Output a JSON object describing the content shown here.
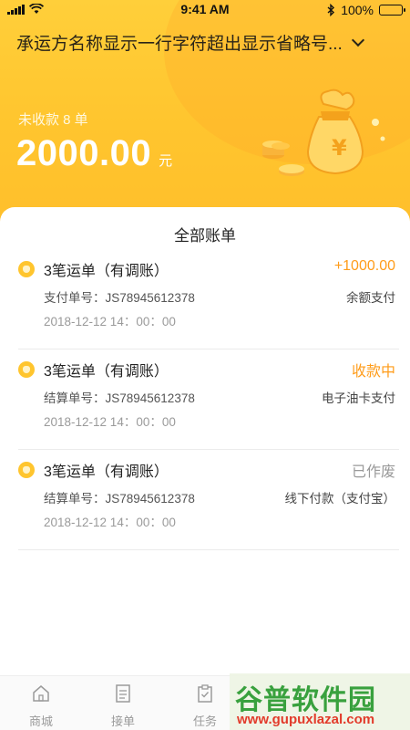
{
  "status_bar": {
    "time": "9:41 AM",
    "battery": "100%",
    "icons": [
      "signal-icon",
      "wifi-icon",
      "bluetooth-icon",
      "battery-icon"
    ]
  },
  "header": {
    "carrier_name": "承运方名称显示一行字符超出显示省略号...",
    "uncollected_label": "未收款 8 单",
    "amount": "2000.00",
    "currency": "元",
    "colors": {
      "primary": "#ffc52e",
      "accent_orange": "#ff9c1a"
    }
  },
  "bills": {
    "title": "全部账单",
    "items": [
      {
        "title": "3笔运单（有调账）",
        "status": "+1000.00",
        "status_color": "#ff9c1a",
        "number": "支付单号：JS78945612378",
        "method": "余额支付",
        "time": "2018-12-12  14：00：00"
      },
      {
        "title": "3笔运单（有调账）",
        "status": "收款中",
        "status_color": "#ff9c1a",
        "number": "结算单号：JS78945612378",
        "method": "电子油卡支付",
        "time": "2018-12-12  14：00：00"
      },
      {
        "title": "3笔运单（有调账）",
        "status": "已作废",
        "status_color": "#999999",
        "number": "结算单号：JS78945612378",
        "method": "线下付款（支付宝）",
        "time": "2018-12-12  14：00：00"
      }
    ]
  },
  "tabbar": {
    "tabs": [
      {
        "label": "商城",
        "icon": "home-icon"
      },
      {
        "label": "接单",
        "icon": "document-icon"
      },
      {
        "label": "任务",
        "icon": "clipboard-icon"
      }
    ]
  },
  "watermark": {
    "main": "谷普软件园",
    "sub": "www.gupuxlazal.com"
  }
}
